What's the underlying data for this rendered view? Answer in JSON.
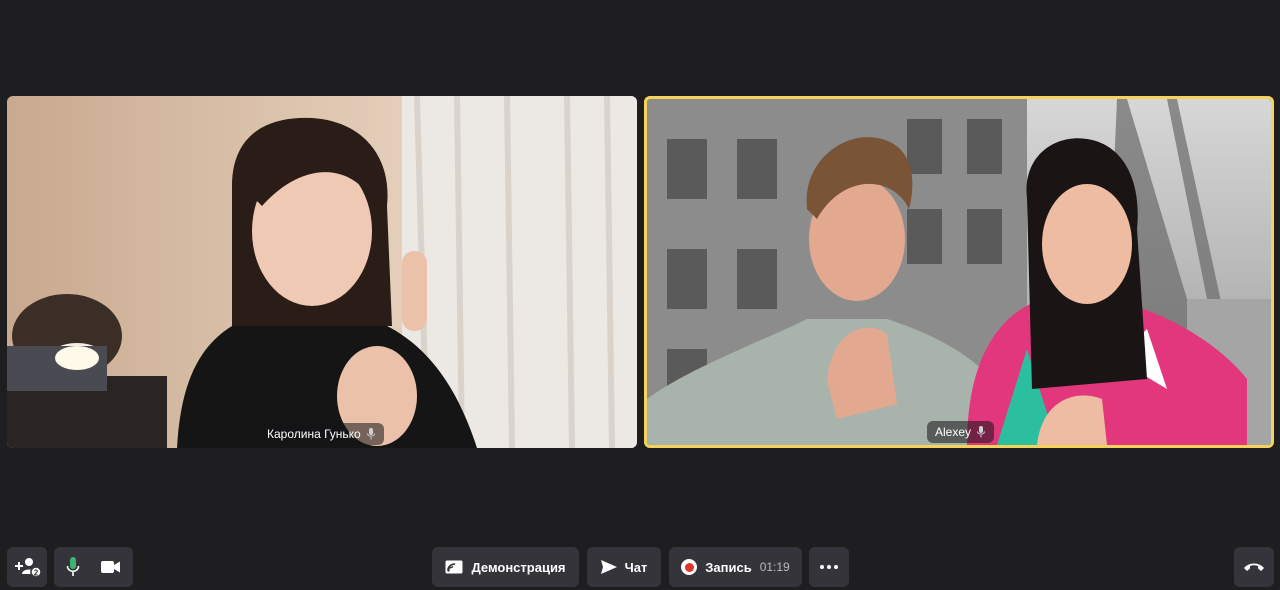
{
  "participants": [
    {
      "name": "Каролина Гунько",
      "mic_icon": "mic-icon",
      "active_speaker": false
    },
    {
      "name": "Alexey",
      "mic_icon": "mic-icon",
      "active_speaker": true,
      "highlight_color": "#f5d35a"
    }
  ],
  "toolbar": {
    "invite_icon": "add-participant-icon",
    "invite_badge": "2",
    "mic_icon": "mic-icon",
    "mic_color": "#3cb371",
    "camera_icon": "camera-icon",
    "screen_share_label": "Демонстрация",
    "chat_label": "Чат",
    "record_label": "Запись",
    "record_time": "01:19",
    "record_color": "#e0342a",
    "more_icon": "more-icon",
    "hangup_icon": "hangup-icon"
  },
  "colors": {
    "background": "#1e1e21",
    "button": "#34343a"
  }
}
